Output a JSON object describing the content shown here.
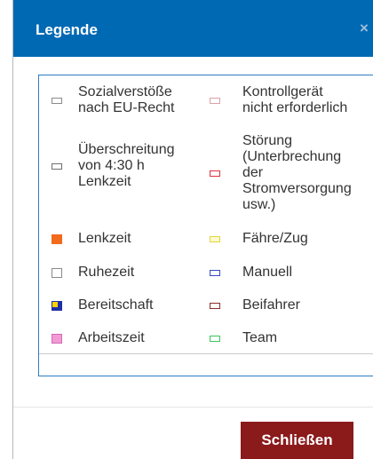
{
  "dialog": {
    "title": "Legende",
    "close_icon": "close-icon",
    "close_glyph": "×",
    "close_button_label": "Schließen"
  },
  "legend": {
    "left": [
      {
        "lines": [
          "Sozialverstöße",
          "nach EU-Recht"
        ],
        "swatch": "#ffffff",
        "border": "#8a8a8a",
        "mark": "#8a8a8a"
      },
      {
        "lines": [
          "Überschreitung",
          "von 4:30 h",
          "Lenkzeit"
        ],
        "swatch": "#ffffff",
        "border": "#6e6e6e",
        "mark": "#555555"
      },
      {
        "lines": [
          "Lenkzeit"
        ],
        "swatch": "#f26a1b",
        "border": "#f26a1b"
      },
      {
        "lines": [
          "Ruhezeit"
        ],
        "swatch": "#ffffff",
        "border": "#8a8a8a"
      },
      {
        "lines": [
          "Bereitschaft"
        ],
        "swatch": "#1f2fa8",
        "border": "#1f2fa8",
        "accent": "#ffd200"
      },
      {
        "lines": [
          "Arbeitszeit"
        ],
        "swatch": "#f29ad4",
        "border": "#d06bb3"
      }
    ],
    "right": [
      {
        "lines": [
          "Kontrollgerät",
          "nicht erforderlich"
        ],
        "swatch": "#ffffff",
        "border": "#d9a3a8"
      },
      {
        "lines": [
          "Störung",
          "(Unterbrechung",
          "der",
          "Stromversorgung",
          "usw.)"
        ],
        "swatch": "#ffffff",
        "border": "#e0313d"
      },
      {
        "lines": [
          "Fähre/Zug"
        ],
        "swatch": "#fffbd1",
        "border": "#e3d63c"
      },
      {
        "lines": [
          "Manuell"
        ],
        "swatch": "#ffffff",
        "border": "#3b49c7"
      },
      {
        "lines": [
          "Beifahrer"
        ],
        "swatch": "#ffffff",
        "border": "#8b2a2a"
      },
      {
        "lines": [
          "Team"
        ],
        "swatch": "#ffffff",
        "border": "#3cc45a"
      }
    ]
  },
  "colors": {
    "header": "#0069b3",
    "legend_border": "#2d7ec3",
    "close_button": "#8b1a1a"
  }
}
